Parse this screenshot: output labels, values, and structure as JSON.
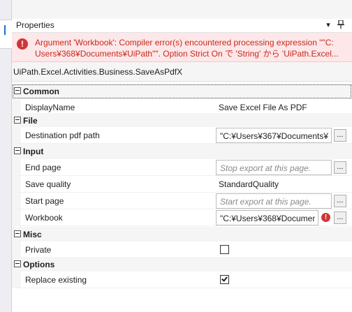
{
  "panel": {
    "title": "Properties",
    "pin_icon": "pin-icon",
    "dropdown_icon": "chevron-down-icon"
  },
  "error": {
    "icon": "error-icon",
    "line1": "Argument 'Workbook': Compiler error(s) encountered processing expression \"\"C:",
    "line2": "Users¥368¥Documents¥UiPath\"\". Option Strict On で 'String' から 'UiPath.Excel..."
  },
  "activity_type": "UiPath.Excel.Activities.Business.SaveAsPdfX",
  "categories": {
    "common": "Common",
    "file": "File",
    "input": "Input",
    "misc": "Misc",
    "options": "Options"
  },
  "properties": {
    "display_name": {
      "label": "DisplayName",
      "value": "Save Excel File As PDF"
    },
    "destination": {
      "label": "Destination pdf path",
      "value": "\"C:¥Users¥367¥Documents¥U"
    },
    "end_page": {
      "label": "End page",
      "placeholder": "Stop export at this page."
    },
    "save_quality": {
      "label": "Save quality",
      "value": "StandardQuality"
    },
    "start_page": {
      "label": "Start page",
      "placeholder": "Start export at this page."
    },
    "workbook": {
      "label": "Workbook",
      "value": "\"C:¥Users¥368¥Document"
    },
    "private": {
      "label": "Private",
      "checked": false
    },
    "replace_existing": {
      "label": "Replace existing",
      "checked": true
    }
  },
  "ellipsis": "...",
  "colors": {
    "error_bg": "#fde7e9",
    "error_text": "#c42b1c",
    "error_icon": "#d13438"
  }
}
